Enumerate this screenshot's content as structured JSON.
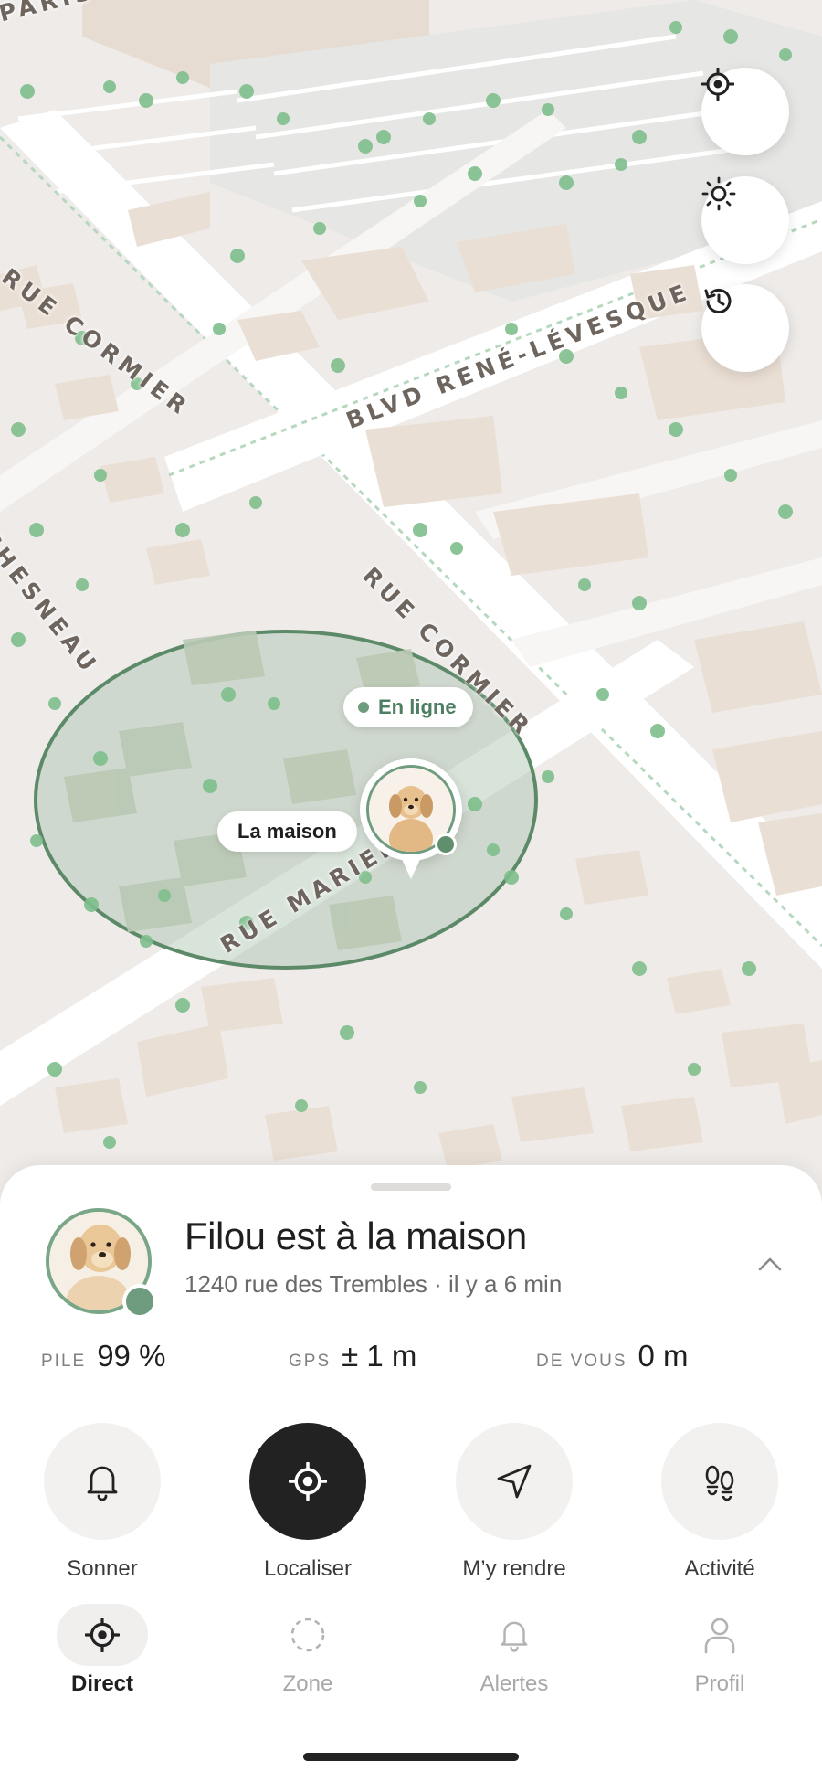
{
  "map": {
    "street_labels": {
      "rue_cormier_top": "RUE CORMIER",
      "blvd_rene_levesque": "BLVD RENÉ-LÉVESQUE",
      "rue_cormier_mid": "RUE CORMIER",
      "rue_marier": "RUE MARIER",
      "chesneau": "CHESNEAU",
      "paris": "PARIS"
    },
    "controls": [
      "recenter-icon",
      "brightness-icon",
      "history-icon"
    ],
    "online_pill": "En ligne",
    "home_pill": "La maison",
    "colors": {
      "zone_fill": "#a9c2ae",
      "zone_stroke": "#5c8a68",
      "road": "#ffffff",
      "building": "#eadfd4",
      "tree": "#7fbf8c"
    }
  },
  "sheet": {
    "title": "Filou est à la maison",
    "subtitle": "1240 rue des Trembles · il y a 6 min",
    "stats": [
      {
        "key": "PILE",
        "value": "99 %"
      },
      {
        "key": "GPS",
        "value": "± 1 m"
      },
      {
        "key": "DE VOUS",
        "value": "0 m"
      }
    ],
    "actions": [
      {
        "label": "Sonner",
        "icon": "bell-icon"
      },
      {
        "label": "Localiser",
        "icon": "locate-icon"
      },
      {
        "label": "M’y rendre",
        "icon": "navigate-icon"
      },
      {
        "label": "Activité",
        "icon": "footprints-icon"
      }
    ]
  },
  "tabs": [
    {
      "label": "Direct",
      "icon": "locate-icon",
      "active": true
    },
    {
      "label": "Zone",
      "icon": "dashed-circle-icon",
      "active": false
    },
    {
      "label": "Alertes",
      "icon": "bell-icon",
      "active": false
    },
    {
      "label": "Profil",
      "icon": "person-icon",
      "active": false
    }
  ],
  "accent": "#6f9c7e"
}
